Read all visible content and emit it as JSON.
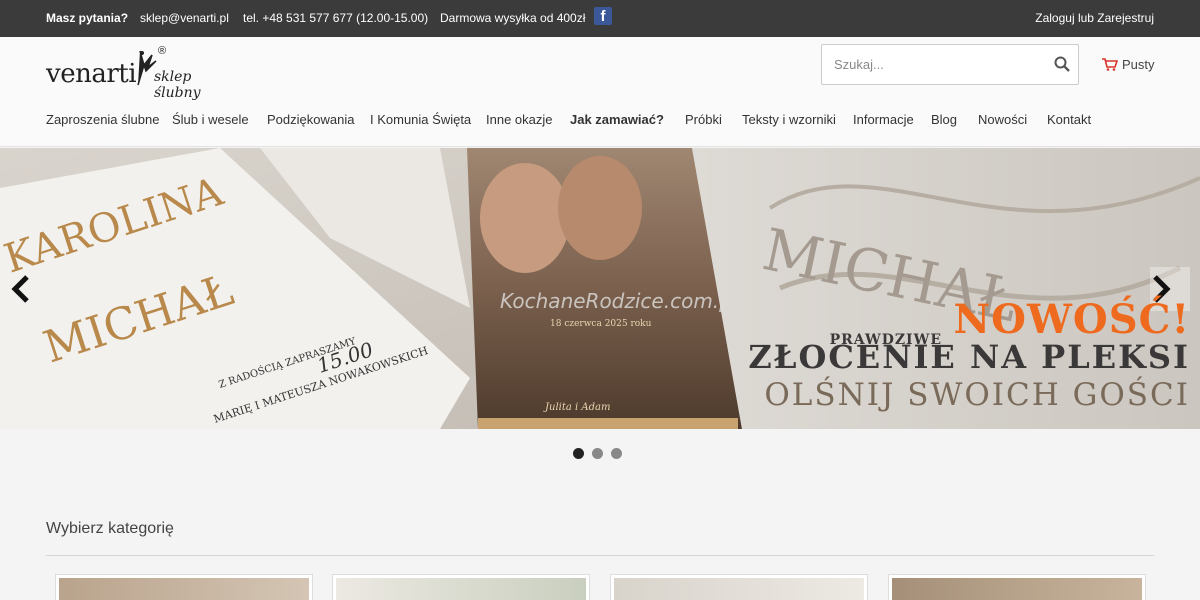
{
  "topbar": {
    "question": "Masz pytania?",
    "email": "sklep@venarti.pl",
    "phone": "tel. +48 531  577  677 (12.00-15.00)",
    "shipping": "Darmowa wysyłka od 400zł",
    "facebook_icon": "facebook-icon",
    "login": "Zaloguj lub Zarejestruj"
  },
  "header": {
    "logo_text": "venarti",
    "logo_script": "sklep ślubny",
    "logo_reg": "®",
    "search_placeholder": "Szukaj...",
    "cart_label": "Pusty"
  },
  "nav": {
    "items": [
      {
        "label": "Zaproszenia ślubne"
      },
      {
        "label": "Ślub i wesele"
      },
      {
        "label": "Podziękowania"
      },
      {
        "label": "I Komunia Święta"
      },
      {
        "label": "Inne okazje"
      },
      {
        "label": "Jak zamawiać?"
      },
      {
        "label": "Próbki"
      },
      {
        "label": "Teksty i wzorniki"
      },
      {
        "label": "Informacje"
      },
      {
        "label": "Blog"
      },
      {
        "label": "Nowości"
      },
      {
        "label": "Kontakt"
      }
    ]
  },
  "slider": {
    "promo_new": "NOWOŚĆ!",
    "promo_pre": "PRAWDZIWE",
    "promo_line1": "ZŁOCENIE NA PLEKSI",
    "promo_line2": "OLŚNIJ SWOICH GOŚCI",
    "card_names": "KAROLINA",
    "card_name2": "MICHAŁ",
    "card_invite": "Z RADOŚCIĄ ZAPRASZAMY",
    "card_guests": "MARIĘ I MATEUSZA NOWAKOWSKICH",
    "card_time": "15.00",
    "watermark": "KochaneRodzice.com.pl",
    "photo_date": "18 czerwca 2025 roku",
    "photo_sign": "Julita i Adam",
    "slide_count": 3,
    "active_slide": 1
  },
  "categories": {
    "title": "Wybierz kategorię"
  },
  "colors": {
    "topbar": "#3b3b3b",
    "accent_orange": "#ee6a1e",
    "facebook": "#3b5998"
  }
}
